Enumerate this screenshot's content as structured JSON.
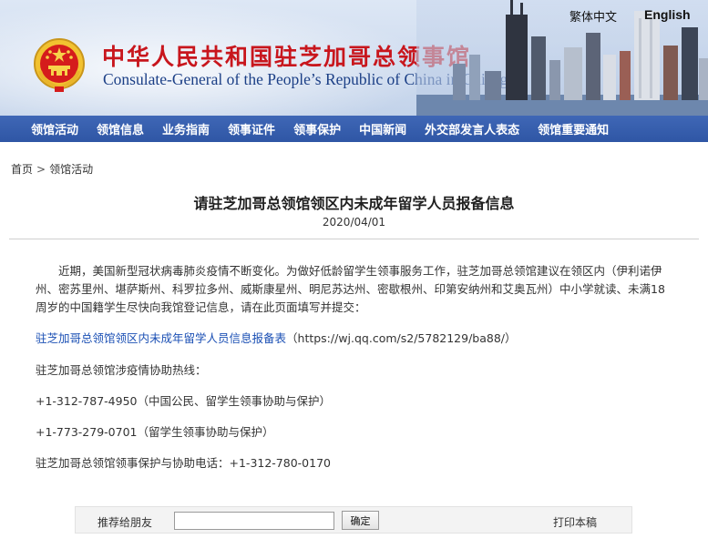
{
  "header": {
    "title_cn": "中华人民共和国驻芝加哥总领事馆",
    "title_en": "Consulate-General of the People’s Republic of China in Chicago",
    "lang_traditional": "繁体中文",
    "lang_english": "English",
    "emblem_icon": "national-emblem-icon"
  },
  "nav": {
    "items": [
      {
        "label": "领馆活动"
      },
      {
        "label": "领馆信息"
      },
      {
        "label": "业务指南"
      },
      {
        "label": "领事证件"
      },
      {
        "label": "领事保护"
      },
      {
        "label": "中国新闻"
      },
      {
        "label": "外交部发言人表态"
      },
      {
        "label": "领馆重要通知"
      }
    ]
  },
  "breadcrumb": {
    "home": "首页",
    "separator": ">",
    "current": "领馆活动"
  },
  "article": {
    "title": "请驻芝加哥总领馆领区内未成年留学人员报备信息",
    "date": "2020/04/01",
    "intro": "近期，美国新型冠状病毒肺炎疫情不断变化。为做好低龄留学生领事服务工作，驻芝加哥总领馆建议在领区内（伊利诺伊州、密苏里州、堪萨斯州、科罗拉多州、威斯康星州、明尼苏达州、密歇根州、印第安纳州和艾奥瓦州）中小学就读、未满18周岁的中国籍学生尽快向我馆登记信息，请在此页面填写并提交：",
    "link_text": "驻芝加哥总领馆领区内未成年留学人员信息报备表",
    "link_url_text": "（https://wj.qq.com/s2/5782129/ba88/）",
    "hotline_heading": "驻芝加哥总领馆涉疫情协助热线：",
    "hotline_1": "+1-312-787-4950（中国公民、留学生领事协助与保护）",
    "hotline_2": "+1-773-279-0701（留学生领事协助与保护）",
    "protection_phone": "驻芝加哥总领馆领事保护与协助电话：+1-312-780-0170"
  },
  "share": {
    "label": "推荐给朋友",
    "input_value": "",
    "button_label": "确定",
    "print_label": "打印本稿"
  },
  "colors": {
    "title_red": "#c8161d",
    "subtitle_blue": "#1b3f86",
    "nav_blue": "#3a62b0",
    "link_blue": "#1a4fb4"
  }
}
